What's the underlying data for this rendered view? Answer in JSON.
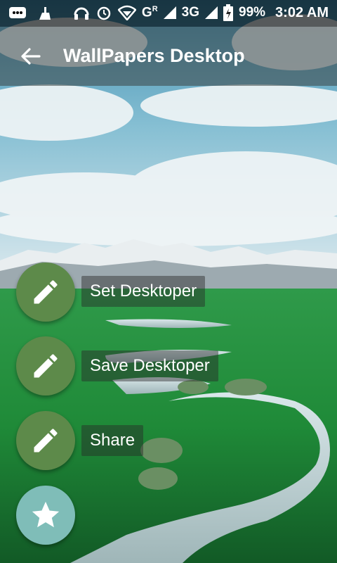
{
  "status_bar": {
    "network_type": "G",
    "network_sub": "R",
    "data_type": "3G",
    "battery": "99%",
    "time": "3:02 AM",
    "icons": [
      "message-icon",
      "clean-icon",
      "headphones-icon",
      "alarm-icon",
      "wifi-icon",
      "signal-icon",
      "battery-icon"
    ]
  },
  "app_bar": {
    "title": "WallPapers Desktop"
  },
  "menu": {
    "items": [
      {
        "label": "Set Desktoper",
        "icon": "pencil-icon"
      },
      {
        "label": "Save Desktoper",
        "icon": "pencil-icon"
      },
      {
        "label": "Share",
        "icon": "pencil-icon"
      }
    ],
    "main_fab_icon": "star-icon"
  },
  "colors": {
    "mini_fab": "#5d8a4a",
    "main_fab": "#7fbdb8"
  }
}
